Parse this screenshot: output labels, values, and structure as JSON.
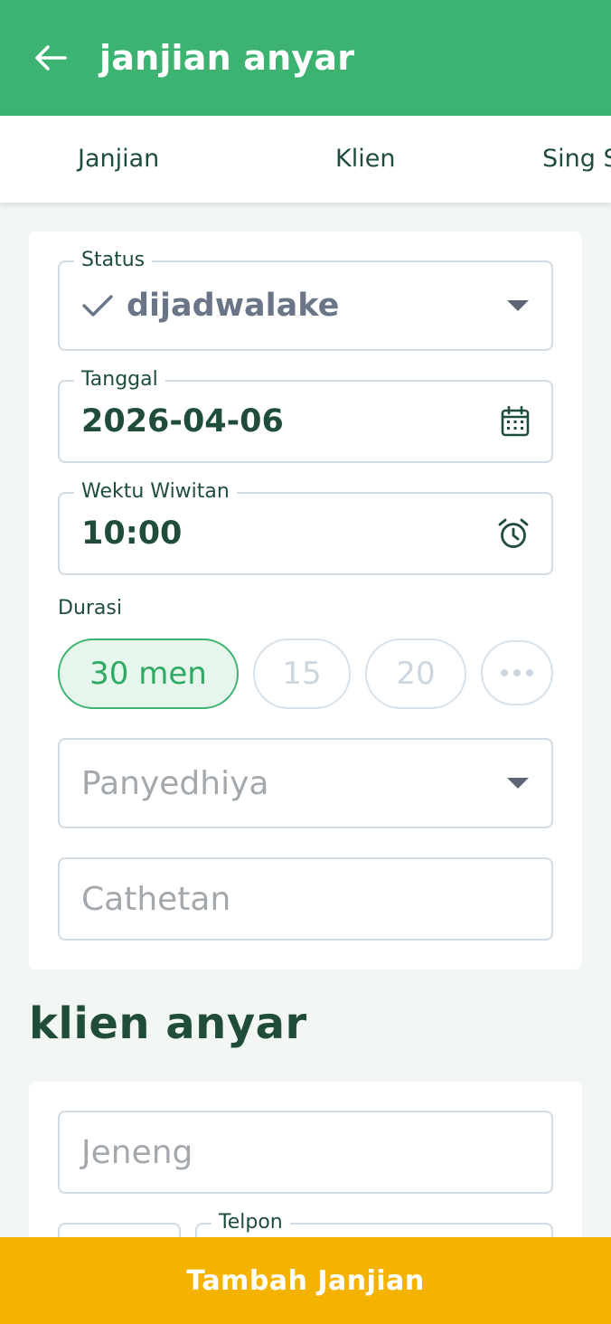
{
  "header": {
    "title": "janjian anyar"
  },
  "tabs": [
    {
      "label": "Janjian"
    },
    {
      "label": "Klien"
    },
    {
      "label": "Sing S"
    }
  ],
  "form": {
    "status": {
      "label": "Status",
      "value": "dijadwalake"
    },
    "date": {
      "label": "Tanggal",
      "value": "2026-04-06"
    },
    "start_time": {
      "label": "Wektu Wiwitan",
      "value": "10:00"
    },
    "duration": {
      "label": "Durasi",
      "options": [
        "30 men",
        "15",
        "20"
      ],
      "selected": "30 men"
    },
    "provider": {
      "placeholder": "Panyedhiya"
    },
    "notes": {
      "placeholder": "Cathetan"
    }
  },
  "new_client": {
    "title": "klien anyar",
    "name": {
      "placeholder": "Jeneng"
    },
    "phone": {
      "label": "Telpon"
    }
  },
  "submit": {
    "label": "Tambah Janjian"
  },
  "colors": {
    "primary": "#3cb371",
    "accent": "#f3b300",
    "text_dark": "#1f4d3a"
  }
}
